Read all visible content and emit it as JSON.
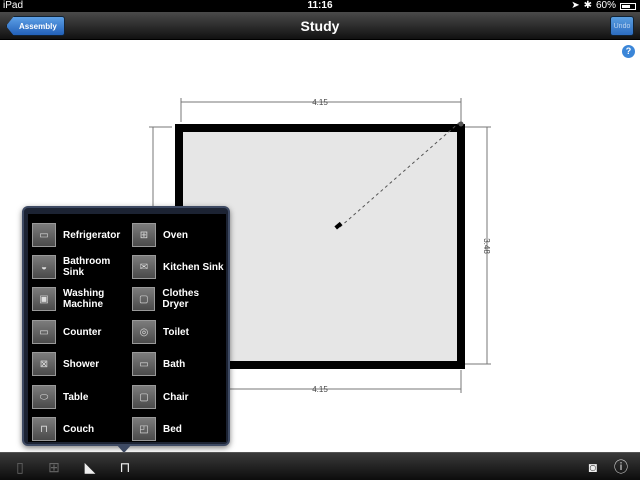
{
  "status": {
    "carrier": "iPad",
    "time": "11:16",
    "battery": "60%"
  },
  "nav": {
    "title": "Study",
    "back_label": "Assembly",
    "undo_label": "Undo"
  },
  "help": {
    "label": "?"
  },
  "plan": {
    "top_dim": "4.15",
    "bottom_dim": "4.15",
    "right_dim": "3.48"
  },
  "menu": {
    "items": [
      {
        "label": "Refrigerator",
        "icon": "refrigerator-icon"
      },
      {
        "label": "Oven",
        "icon": "oven-icon"
      },
      {
        "label": "Bathroom Sink",
        "icon": "bathroom-sink-icon"
      },
      {
        "label": "Kitchen Sink",
        "icon": "kitchen-sink-icon"
      },
      {
        "label": "Washing Machine",
        "icon": "washing-machine-icon"
      },
      {
        "label": "Clothes Dryer",
        "icon": "clothes-dryer-icon"
      },
      {
        "label": "Counter",
        "icon": "counter-icon"
      },
      {
        "label": "Toilet",
        "icon": "toilet-icon"
      },
      {
        "label": "Shower",
        "icon": "shower-icon"
      },
      {
        "label": "Bath",
        "icon": "bath-icon"
      },
      {
        "label": "Table",
        "icon": "table-icon"
      },
      {
        "label": "Chair",
        "icon": "chair-icon"
      },
      {
        "label": "Couch",
        "icon": "couch-icon"
      },
      {
        "label": "Bed",
        "icon": "bed-icon"
      }
    ]
  },
  "toolbar": {
    "left": [
      "door-icon",
      "window-icon",
      "stairs-icon",
      "furniture-icon"
    ],
    "right": [
      "camera-icon",
      "info-icon"
    ]
  }
}
